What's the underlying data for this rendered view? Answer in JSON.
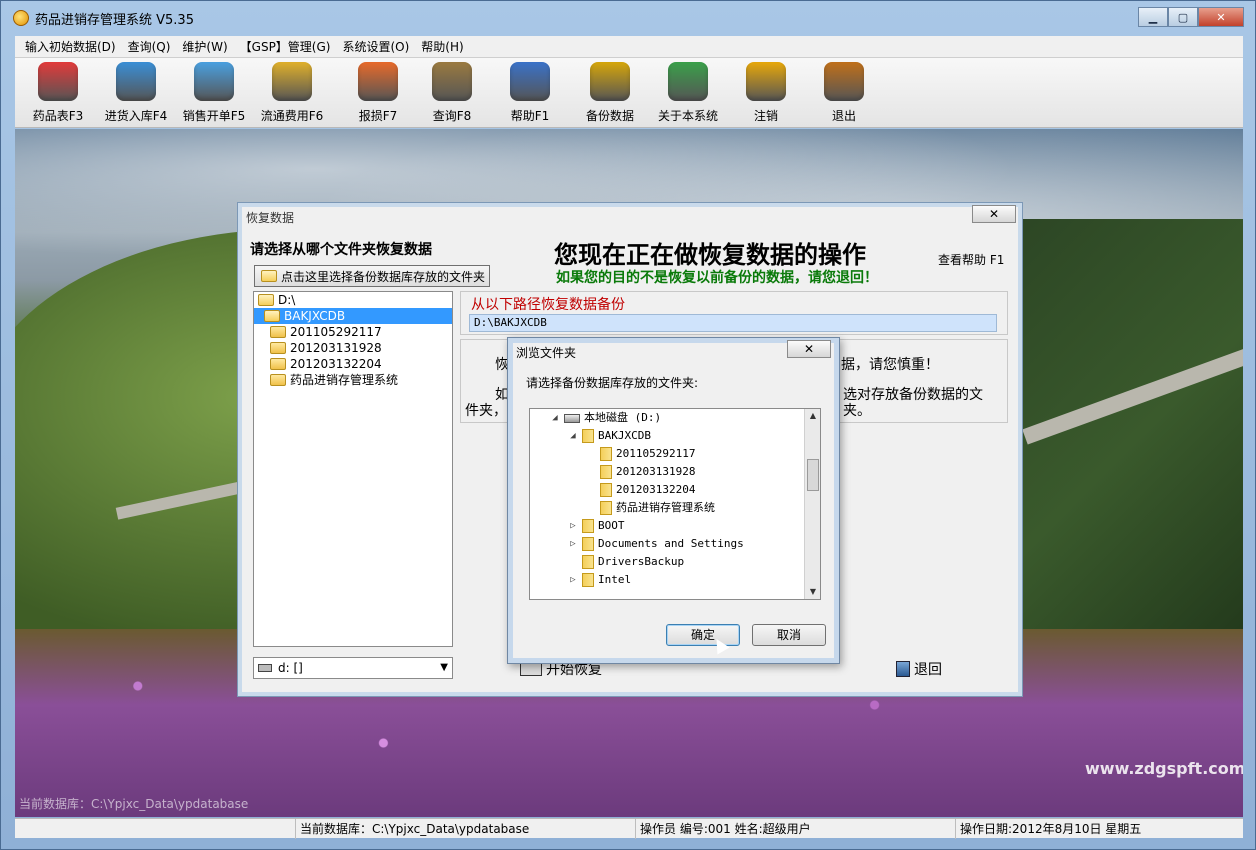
{
  "window": {
    "title": "药品进销存管理系统 V5.35",
    "minimize": "▁",
    "maximize": "▢",
    "close": "✕"
  },
  "menu": [
    "输入初始数据(D)",
    "查询(Q)",
    "维护(W)",
    "【GSP】管理(G)",
    "系统设置(O)",
    "帮助(H)"
  ],
  "toolbar": [
    {
      "label": "药品表F3",
      "icon": "butterfly-icon",
      "color": "#e23a3a"
    },
    {
      "label": "进货入库F4",
      "icon": "house-icon",
      "color": "#3a8fd6"
    },
    {
      "label": "销售开单F5",
      "icon": "document-star-icon",
      "color": "#4aa0e0"
    },
    {
      "label": "流通费用F6",
      "icon": "vehicle-icon",
      "color": "#e0b02a"
    },
    {
      "label": "报损F7",
      "icon": "pie-chart-icon",
      "color": "#e86a2a"
    },
    {
      "label": "查询F8",
      "icon": "magnifier-icon",
      "color": "#9a7a40"
    },
    {
      "label": "帮助F1",
      "icon": "puzzle-help-icon",
      "color": "#3a72c8"
    },
    {
      "label": "备份数据",
      "icon": "database-icon",
      "color": "#d6a60a"
    },
    {
      "label": "关于本系统",
      "icon": "house-globe-icon",
      "color": "#3aa04a"
    },
    {
      "label": "注销",
      "icon": "key-icon",
      "color": "#e8a80a"
    },
    {
      "label": "退出",
      "icon": "exit-door-icon",
      "color": "#c0701a"
    }
  ],
  "scene": {
    "watermark": "www.zdgspft.com",
    "db_overlay": "当前数据库：C:\\Ypjxc_Data\\ypdatabase"
  },
  "restore": {
    "title": "恢复数据",
    "close": "✕",
    "choose_label": "请选择从哪个文件夹恢复数据",
    "pick_button": "点击这里选择备份数据库存放的文件夹",
    "headline": "您现在正在做恢复数据的操作",
    "help": "查看帮助 F1",
    "warning": "如果您的目的不是恢复以前备份的数据，请您退回！",
    "tree": [
      {
        "name": "D:\\",
        "indent": 0,
        "open": true,
        "selected": false
      },
      {
        "name": "BAKJXCDB",
        "indent": 1,
        "open": true,
        "selected": true
      },
      {
        "name": "201105292117",
        "indent": 2,
        "open": false,
        "selected": false
      },
      {
        "name": "201203131928",
        "indent": 2,
        "open": false,
        "selected": false
      },
      {
        "name": "201203132204",
        "indent": 2,
        "open": false,
        "selected": false
      },
      {
        "name": "药品进销存管理系统",
        "indent": 2,
        "open": false,
        "selected": false
      }
    ],
    "path_title": "从以下路径恢复数据备份",
    "path_value": "D:\\BAKJXCDB",
    "info_1a": "恢",
    "info_1b": "据，请您慎重！",
    "info_2a": "如",
    "info_2b": "选对存放备份数据的文",
    "info_3a": "件夹，",
    "info_3b": "夹。",
    "drive": "d: []",
    "start_button": "开始恢复",
    "exit_button": "退回"
  },
  "browse": {
    "title": "浏览文件夹",
    "close": "✕",
    "prompt": "请选择备份数据库存放的文件夹:",
    "tree": [
      {
        "name": "本地磁盘 (D:)",
        "indent": 2,
        "twisty": "◢",
        "type": "drive"
      },
      {
        "name": "BAKJXCDB",
        "indent": 3,
        "twisty": "◢",
        "type": "folder"
      },
      {
        "name": "201105292117",
        "indent": 4,
        "twisty": "",
        "type": "folder"
      },
      {
        "name": "201203131928",
        "indent": 4,
        "twisty": "",
        "type": "folder"
      },
      {
        "name": "201203132204",
        "indent": 4,
        "twisty": "",
        "type": "folder"
      },
      {
        "name": "药品进销存管理系统",
        "indent": 4,
        "twisty": "",
        "type": "folder"
      },
      {
        "name": "BOOT",
        "indent": 3,
        "twisty": "▷",
        "type": "folder"
      },
      {
        "name": "Documents and Settings",
        "indent": 3,
        "twisty": "▷",
        "type": "folder"
      },
      {
        "name": "DriversBackup",
        "indent": 3,
        "twisty": "",
        "type": "folder"
      },
      {
        "name": "Intel",
        "indent": 3,
        "twisty": "▷",
        "type": "folder"
      }
    ],
    "ok": "确定",
    "cancel": "取消"
  },
  "status": {
    "database": "当前数据库：C:\\Ypjxc_Data\\ypdatabase",
    "operator": "操作员 编号:001  姓名:超级用户",
    "date": "操作日期:2012年8月10日 星期五"
  }
}
